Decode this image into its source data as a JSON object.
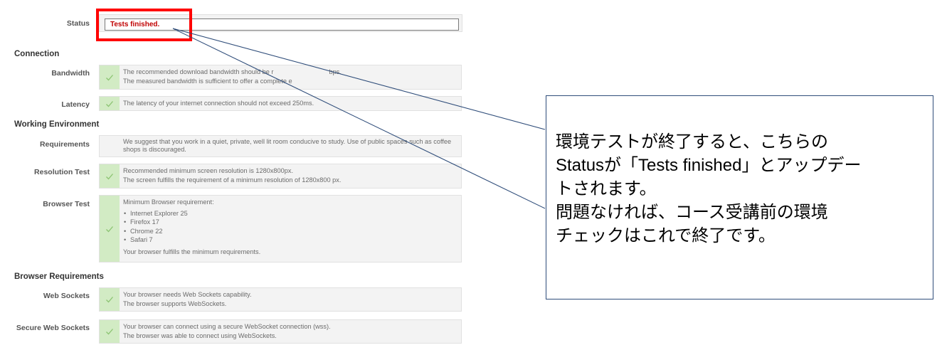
{
  "status": {
    "label": "Status",
    "value": "Tests finished."
  },
  "sections": {
    "connection": "Connection",
    "working": "Working Environment",
    "browser_req": "Browser Requirements"
  },
  "rows": {
    "bandwidth": {
      "label": "Bandwidth",
      "line1": "The recommended download bandwidth should be r",
      "line1_tail": "bps.",
      "line2": "The measured bandwidth is sufficient to offer a complete e"
    },
    "latency": {
      "label": "Latency",
      "line1": "The latency of your internet connection should not exceed 250ms."
    },
    "requirements": {
      "label": "Requirements",
      "line1": "We suggest that you work in a quiet, private, well lit room conducive to study. Use of public spaces such as coffee shops is discouraged."
    },
    "resolution": {
      "label": "Resolution Test",
      "line1": "Recommended minimum screen resolution is 1280x800px.",
      "line2": "The screen fulfills the requirement of a minimum resolution of 1280x800 px."
    },
    "browser": {
      "label": "Browser Test",
      "line1": "Minimum Browser requirement:",
      "items": [
        "Internet Explorer 25",
        "Firefox 17",
        "Chrome 22",
        "Safari 7"
      ],
      "line2": "Your browser fulfills the minimum requirements."
    },
    "websockets": {
      "label": "Web Sockets",
      "line1": "Your browser needs Web Sockets capability.",
      "line2": "The browser supports WebSockets."
    },
    "secure_ws": {
      "label": "Secure Web Sockets",
      "line1": "Your browser can connect using a secure WebSocket connection (wss).",
      "line2": "The browser was able to connect using WebSockets."
    }
  },
  "callout": {
    "lines": [
      "環境テストが終了すると、こちらの",
      "Statusが「Tests finished」とアップデー",
      "トされます。",
      "問題なければ、コース受講前の環境",
      "チェックはこれで終了です。"
    ]
  },
  "colors": {
    "highlight": "#ff0000",
    "status_text": "#c00000",
    "check_bg": "#d2ebc4",
    "check_mark": "#8cc472",
    "callout_border": "#2f4d7a"
  }
}
